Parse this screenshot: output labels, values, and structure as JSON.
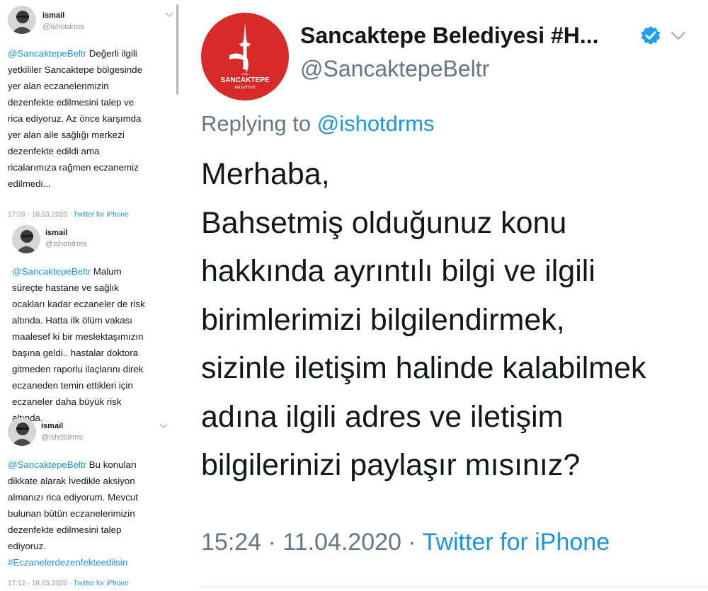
{
  "left_thread": [
    {
      "name": "ismail",
      "handle": "@ishotdrms",
      "mention": "@SancaktepeBeltr",
      "text": " Değerli ilgili\nyetkililer Sancaktepe bölgesinde\nyer alan eczanelerimizin\ndezenfekte edilmesini talep ve\nrica ediyoruz. Az önce karşımda\nyer alan aile sağlığı merkezi\ndezenfekte edildi ama\nricalarımıza rağmen eczanemiz\nedilmedi...",
      "time": "17:09 · 18.03.2020 · ",
      "source": "Twitter for iPhone"
    },
    {
      "name": "ismail",
      "handle": "@ishotdrms",
      "mention": "@SancaktepeBeltr",
      "text": " Malum\nsüreçte hastane ve sağlık\nocakları kadar eczaneler de risk\naltında. Hatta ilk ölüm vakası\nmaalesef ki bir meslektaşımızın\nbaşına geldi.. hastalar doktora\ngitmeden raporlu ilaçlarını direk\neczaneden temin ettikleri için\neczaneler daha büyük risk\naltında."
    },
    {
      "name": "ismail",
      "handle": "@ishotdrms",
      "mention": "@SancaktepeBeltr",
      "text": " Bu konuları\ndikkate alarak İvedikle aksiyon\nalmanızı rica ediyorum. Mevcut\nbulunan bütün eczanelerimizin\ndezenfekte edilmesini talep\nediyoruz.",
      "hashtag": "#Eczanelerdezenfekteedilsin",
      "time": "17:12 · 18.03.2020 · ",
      "source": "Twitter for iPhone"
    }
  ],
  "main_tweet": {
    "display_name": "Sancaktepe Belediyesi #H...",
    "handle": "@SancaktepeBeltr",
    "logo_text": "SANCAKTEPE",
    "logo_subtext": "BELEDİYESİ",
    "logo_year": "2008",
    "replying_prefix": "Replying to ",
    "replying_to": "@ishotdrms",
    "lines": [
      "Merhaba,",
      "Bahsetmiş olduğunuz konu",
      "hakkında ayrıntılı bilgi ve ilgili",
      "birimlerimizi bilgilendirmek,",
      "sizinle iletişim halinde kalabilmek",
      "adına ilgili adres ve iletişim",
      "bilgilerinizi paylaşır mısınız?"
    ],
    "time": "15:24 · 11.04.2020 · ",
    "source": "Twitter for iPhone"
  },
  "colors": {
    "link": "#1b95e0",
    "muted": "#657786",
    "logo_red": "#d92a2a",
    "verified": "#1da1f2"
  },
  "icons": [
    "avatar-photo",
    "chevron-down-icon",
    "verified-badge-icon",
    "municipality-logo"
  ]
}
